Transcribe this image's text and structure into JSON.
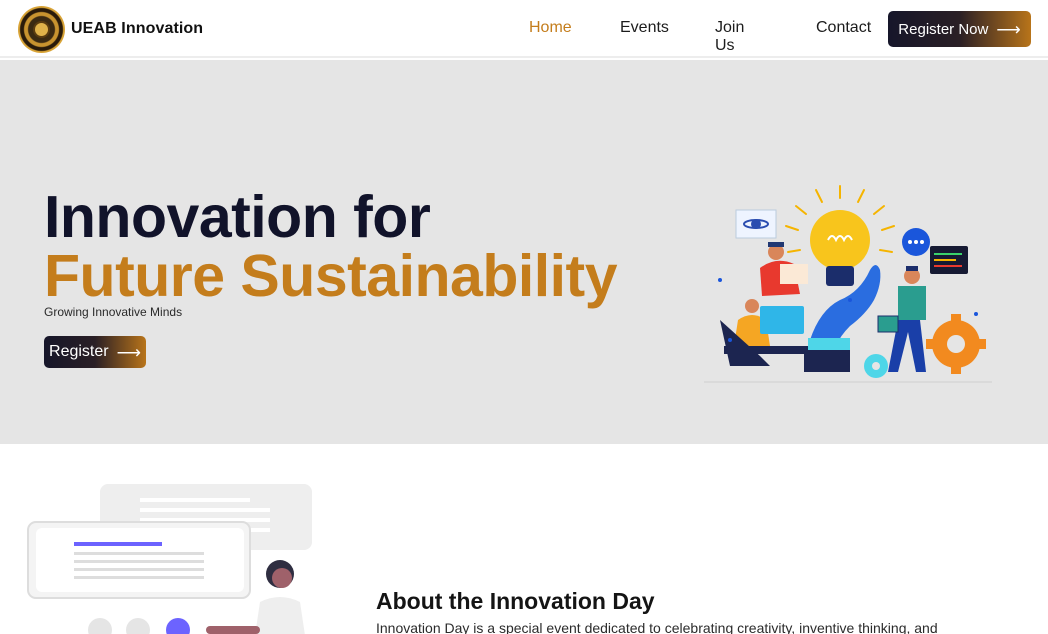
{
  "brand": {
    "name": "UEAB Innovation",
    "logo_icon": "university-seal-icon"
  },
  "nav": {
    "links": [
      {
        "label": "Home",
        "active": true
      },
      {
        "label": "Events",
        "active": false
      },
      {
        "label": "Join Us",
        "active": false
      },
      {
        "label": "Contact",
        "active": false
      }
    ],
    "cta_label": "Register Now",
    "cta_icon": "arrow-right-icon"
  },
  "hero": {
    "title_line1": "Innovation for",
    "title_line2": "Future Sustainability",
    "subtitle": "Growing Innovative Minds",
    "button_label": "Register",
    "button_icon": "arrow-right-icon",
    "illustration": "innovation-team-lightbulb-illustration"
  },
  "about": {
    "title": "About the Innovation Day",
    "text": "Innovation Day is a special event dedicated to celebrating creativity, inventive thinking, and",
    "illustration": "person-with-message-cards-illustration"
  },
  "colors": {
    "accent": "#c47d1c",
    "dark": "#11132a",
    "hero_bg": "#e5e5e5",
    "button_gradient_start": "#16162a",
    "button_gradient_end": "#b8741a"
  }
}
